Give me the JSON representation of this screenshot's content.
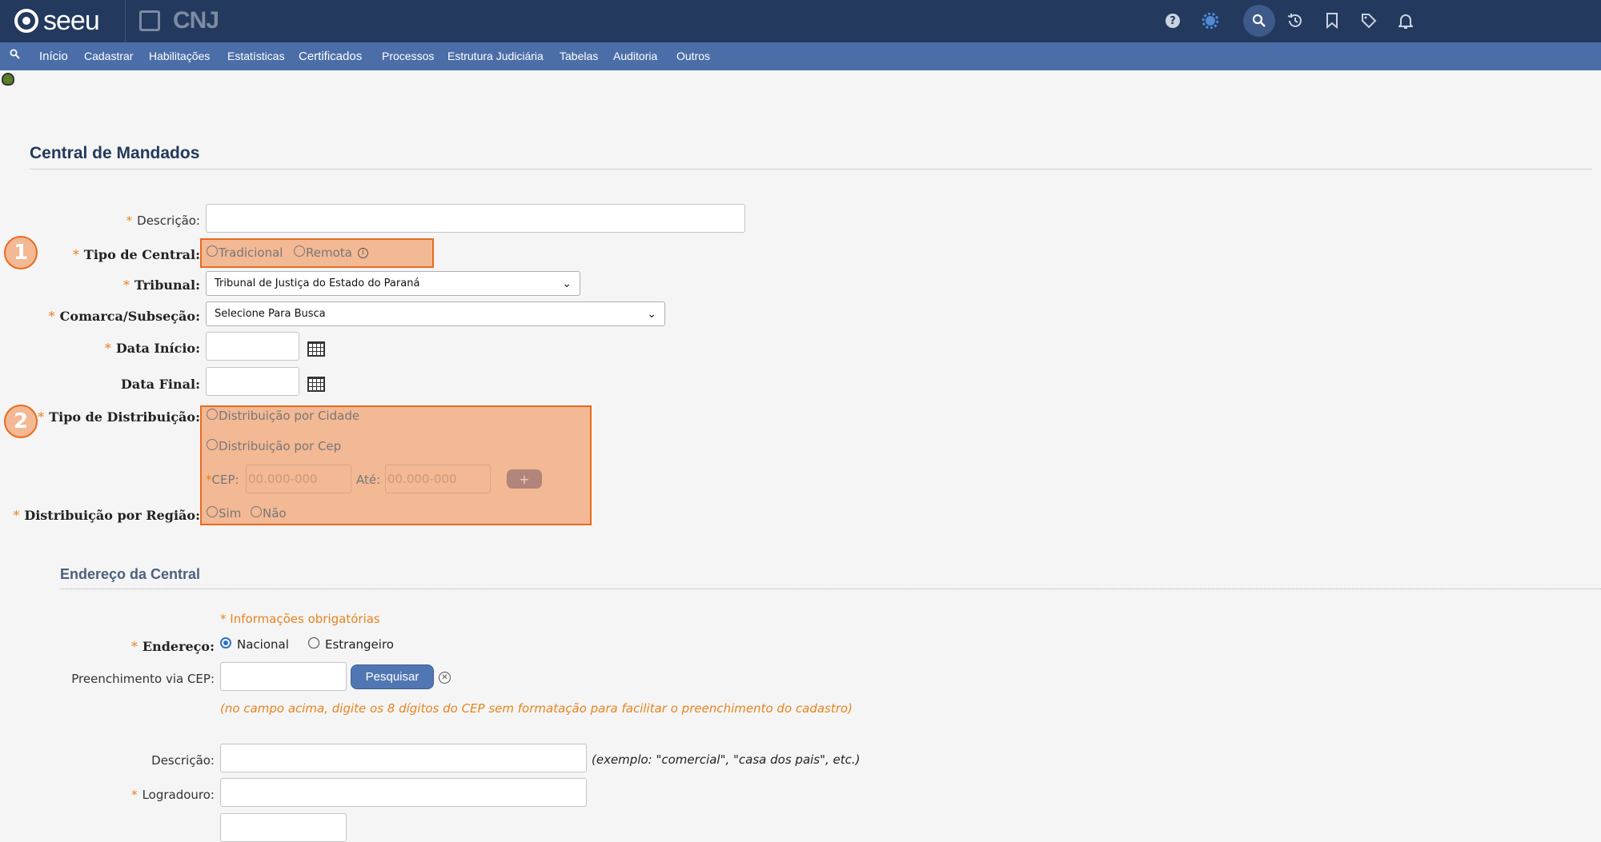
{
  "header": {
    "logo_text": "seeu",
    "cnj_text": "CNJ"
  },
  "menu": {
    "items": [
      "Início",
      "Cadastrar",
      "Habilitações",
      "Estatísticas",
      "Certificados",
      "Processos",
      "Estrutura Judiciária",
      "Tabelas",
      "Auditoria",
      "Outros"
    ]
  },
  "page": {
    "title": "Central de Mandados"
  },
  "form": {
    "descricao_label": "Descrição:",
    "tipo_central_label": "Tipo de Central:",
    "tipo_central_options": [
      "Tradicional",
      "Remota"
    ],
    "tribunal_label": "Tribunal:",
    "tribunal_value": "Tribunal de Justiça do Estado do Paraná",
    "comarca_label": "Comarca/Subseção:",
    "comarca_value": "Selecione Para Busca",
    "data_inicio_label": "Data Início:",
    "data_final_label": "Data Final:",
    "tipo_distribuicao_label": "Tipo de Distribuição:",
    "distribuicao_cidade": "Distribuição por Cidade",
    "distribuicao_cep": "Distribuição por Cep",
    "cep_label": "CEP:",
    "cep_placeholder": "00.000-000",
    "ate_label": "Até:",
    "ate_placeholder": "00.000-000",
    "plus_label": "+",
    "distribuicao_regiao_label": "Distribuição por Região:",
    "regiao_options": [
      "Sim",
      "Não"
    ]
  },
  "steps": [
    "1",
    "2"
  ],
  "endereco": {
    "section_title": "Endereço da Central",
    "required_note": "* Informações obrigatórias",
    "endereco_label": "Endereço:",
    "endereco_options": [
      "Nacional",
      "Estrangeiro"
    ],
    "endereco_selected": "Nacional",
    "cep_fill_label": "Preenchimento via CEP:",
    "pesquisar_label": "Pesquisar",
    "cep_hint": "(no campo acima, digite os 8 dígitos do CEP sem formatação para facilitar o preenchimento do cadastro)",
    "descricao_label": "Descrição:",
    "descricao_hint": "(exemplo: \"comercial\", \"casa dos pais\", etc.)",
    "logradouro_label": "Logradouro:"
  },
  "colors": {
    "topbar": "#23395d",
    "menubar": "#4b6ea9",
    "highlight_fill": "#f3b894",
    "highlight_border": "#ea6a1e",
    "required_star": "#e8831e"
  }
}
